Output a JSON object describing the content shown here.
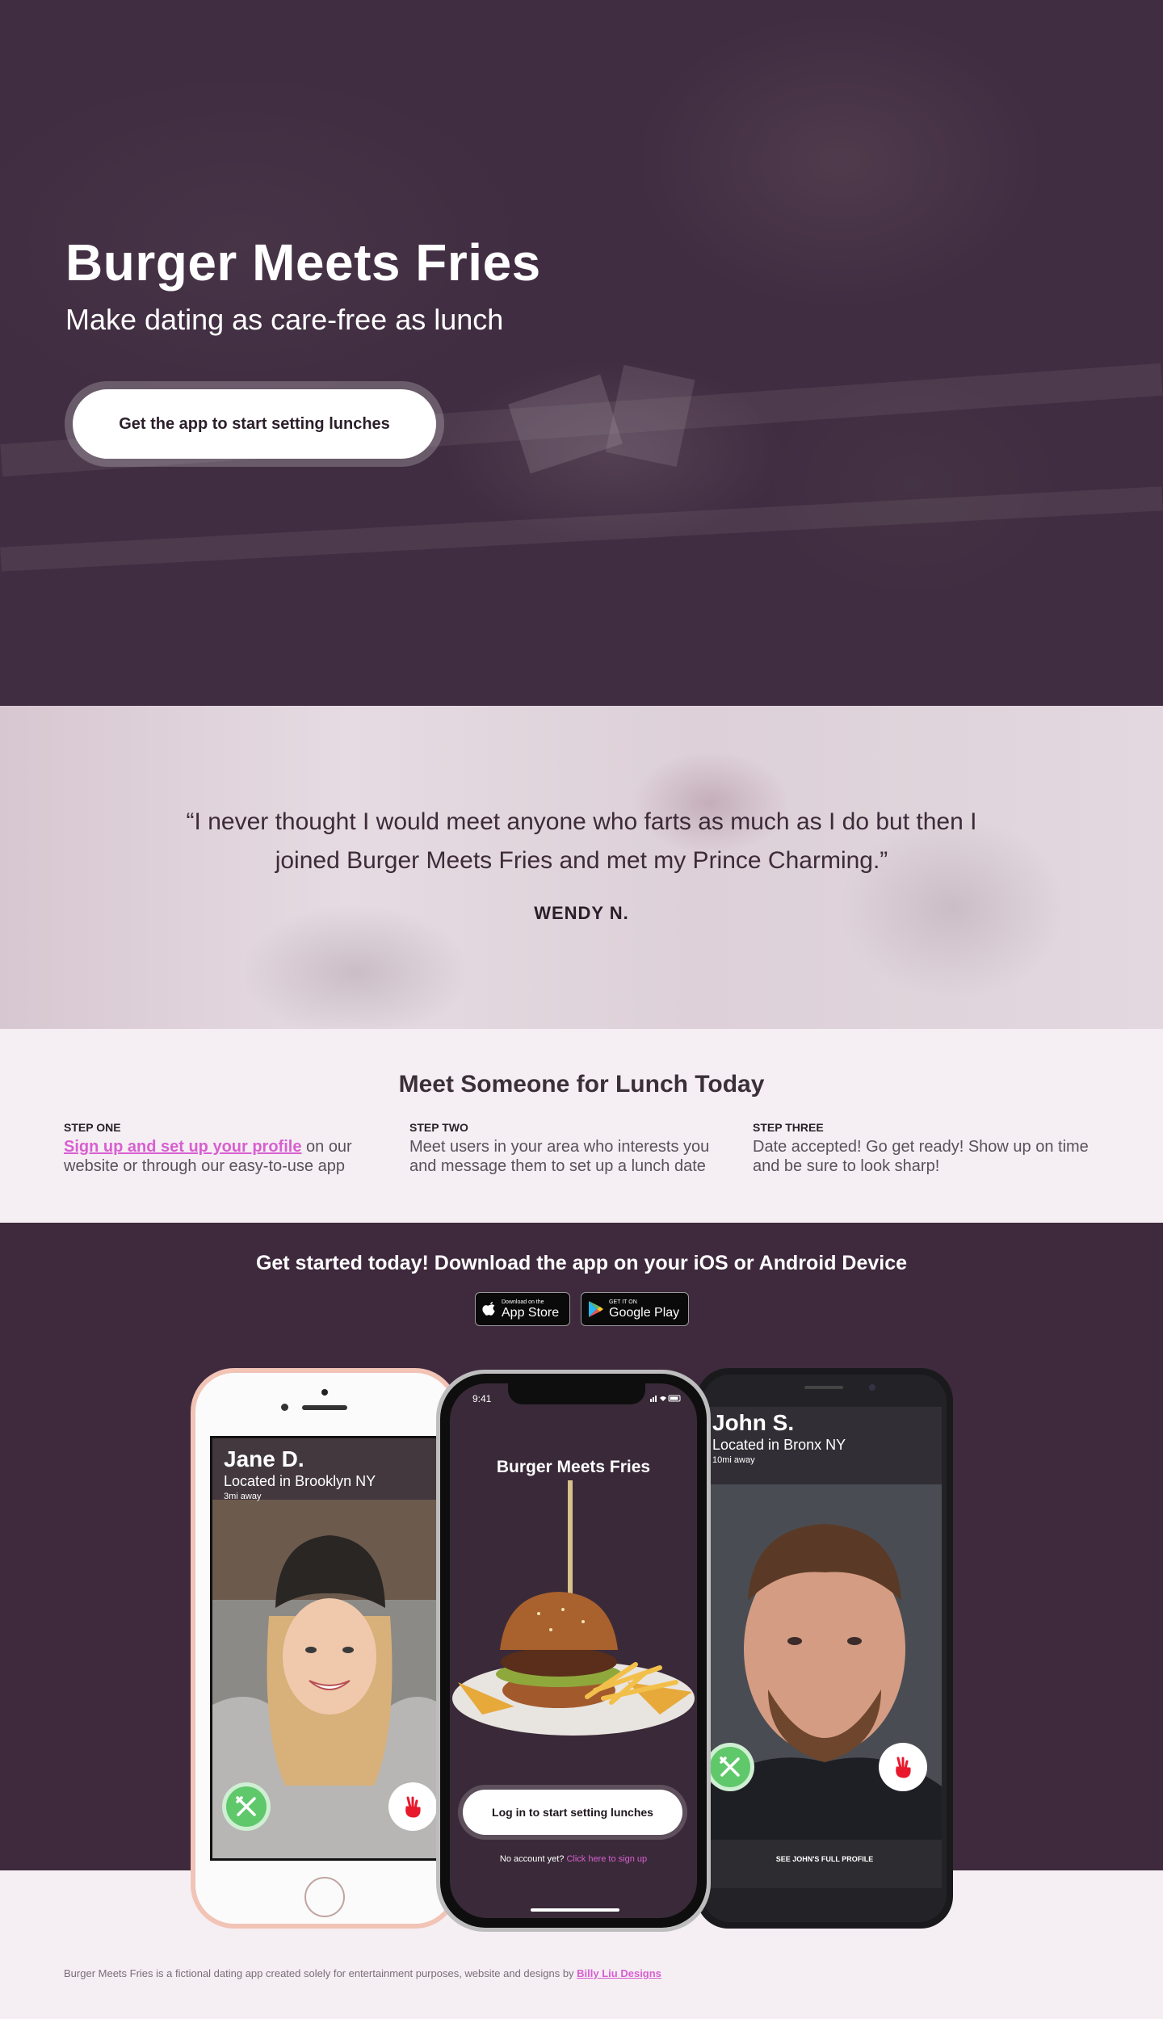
{
  "hero": {
    "title": "Burger Meets Fries",
    "subtitle": "Make dating as care-free as lunch",
    "cta_label": "Get the app to start setting lunches"
  },
  "testimonial": {
    "quote": "“I never thought I would meet anyone who farts as much as I do but then I joined Burger Meets Fries and met my Prince Charming.”",
    "author": "WENDY N."
  },
  "steps": {
    "title": "Meet Someone for Lunch Today",
    "items": [
      {
        "label": "STEP ONE",
        "link": "Sign up and set up your profile",
        "text": " on our website or through our easy-to-use app"
      },
      {
        "label": "STEP TWO",
        "text": "Meet users in your area who interests you and message them to set up a lunch date"
      },
      {
        "label": "STEP THREE",
        "text": "Date accepted! Go get ready! Show up on time and be sure to look sharp!"
      }
    ]
  },
  "download": {
    "title": "Get started today! Download the app on your iOS or Android Device",
    "appstore_small": "Download on the",
    "appstore_big": "App Store",
    "googleplay_small": "GET IT ON",
    "googleplay_big": "Google Play"
  },
  "phone_left": {
    "name": "Jane D.",
    "location": "Located in Brooklyn NY",
    "distance": "3mi away"
  },
  "phone_center": {
    "time": "9:41",
    "title": "Burger Meets Fries",
    "login_label": "Log in to start setting lunches",
    "no_account": "No account yet? ",
    "signup_link": "Click here to sign up"
  },
  "phone_right": {
    "name": "John S.",
    "location": "Located in Bronx NY",
    "distance": "10mi away",
    "profile_link": "SEE JOHN'S FULL PROFILE"
  },
  "footer": {
    "text": "Burger Meets Fries is a fictional dating app created solely for entertainment purposes, website and designs by ",
    "link": "Billy Liu Designs"
  },
  "colors": {
    "plum": "#3f2a3d",
    "accent": "#d85fd0",
    "like_green": "#5fc86b",
    "pass_red": "#e8192c"
  }
}
